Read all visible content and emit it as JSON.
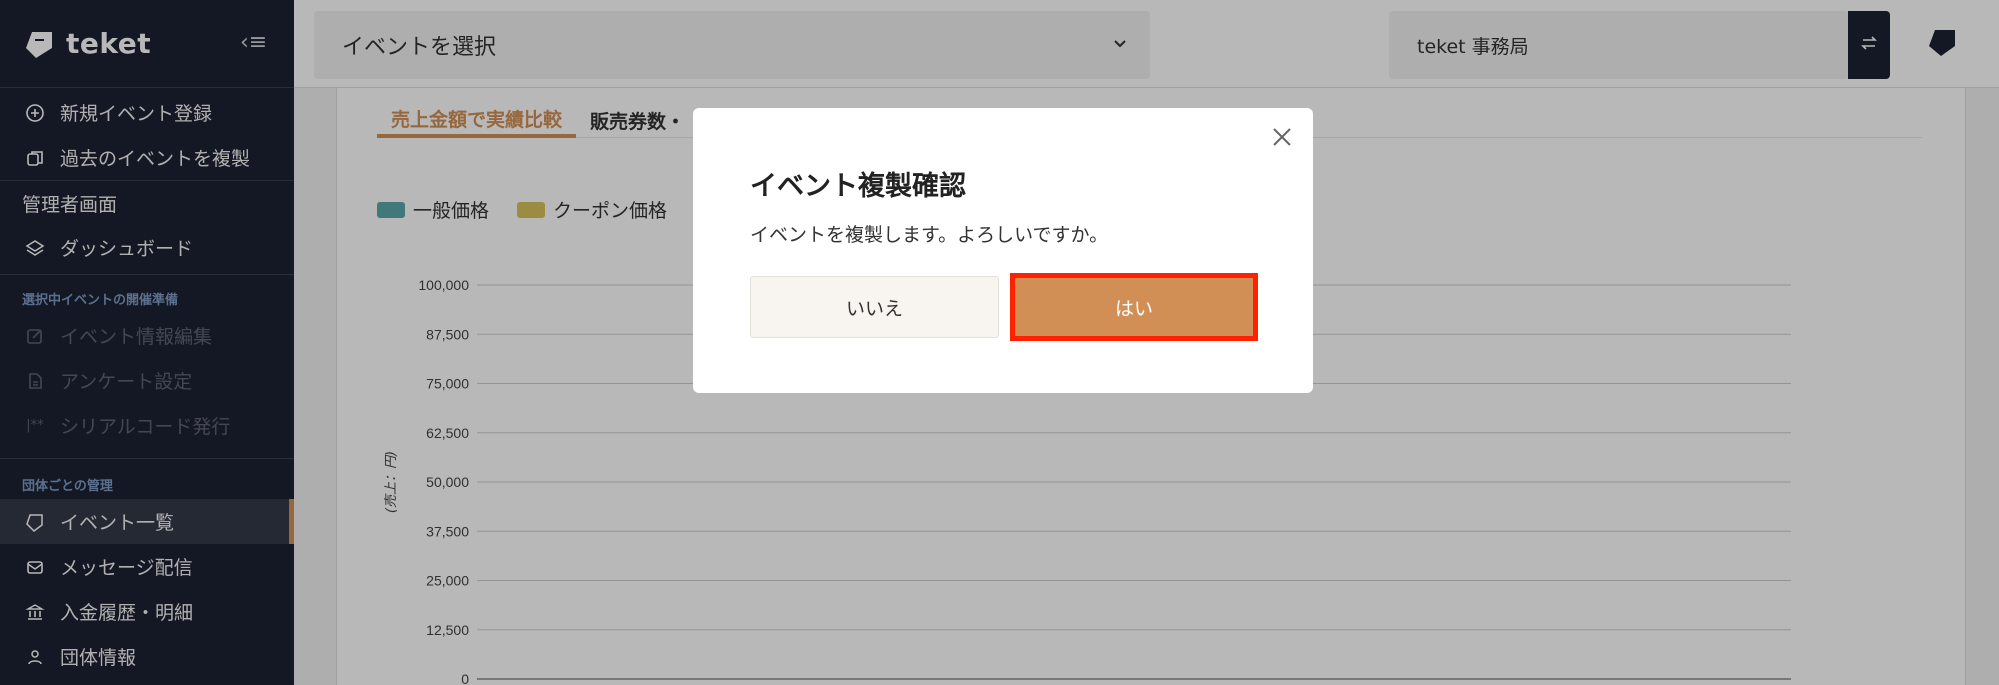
{
  "sidebar": {
    "logo_text": "teket",
    "collapse_icon": "‹≡",
    "items_top": [
      {
        "label": "新規イベント登録",
        "icon": "plus-circle-icon"
      },
      {
        "label": "過去のイベントを複製",
        "icon": "copy-icon"
      }
    ],
    "admin_label": "管理者画面",
    "dashboard_label": "ダッシュボード",
    "section_event_prep": "選択中イベントの開催準備",
    "items_prep": [
      {
        "label": "イベント情報編集",
        "icon": "edit-icon"
      },
      {
        "label": "アンケート設定",
        "icon": "document-icon"
      },
      {
        "label": "シリアルコード発行",
        "icon": "serial-code-icon"
      }
    ],
    "section_group": "団体ごとの管理",
    "items_group": [
      {
        "label": "イベント一覧",
        "icon": "ticket-icon"
      },
      {
        "label": "メッセージ配信",
        "icon": "mail-icon"
      },
      {
        "label": "入金履歴・明細",
        "icon": "bank-icon"
      },
      {
        "label": "団体情報",
        "icon": "group-icon"
      }
    ]
  },
  "header": {
    "event_select_label": "イベントを選択",
    "org_label": "teket 事務局"
  },
  "main": {
    "tabs": [
      {
        "label": "売上金額で実績比較",
        "active": true
      },
      {
        "label": "販売券数・"
      }
    ],
    "legend": [
      {
        "label": "一般価格",
        "color": "#5aa7a8"
      },
      {
        "label": "クーポン価格",
        "color": "#d9c35c"
      }
    ]
  },
  "chart_data": {
    "type": "bar",
    "ylabel": "(売上：円)",
    "ylim": [
      0,
      100000
    ],
    "yticks": [
      "100,000",
      "87,500",
      "75,000",
      "62,500",
      "50,000",
      "37,500",
      "25,000",
      "12,500",
      "0"
    ],
    "series": [
      {
        "name": "一般価格",
        "values": []
      },
      {
        "name": "クーポン価格",
        "values": []
      }
    ]
  },
  "modal": {
    "title": "イベント複製確認",
    "message": "イベントを複製します。よろしいですか。",
    "no_label": "いいえ",
    "yes_label": "はい"
  }
}
